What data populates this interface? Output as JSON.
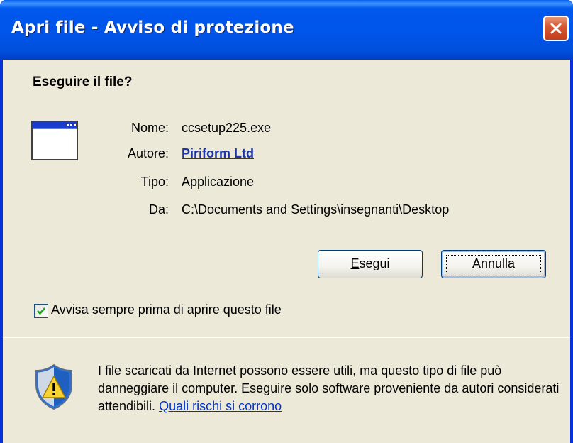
{
  "window": {
    "title": "Apri file - Avviso di protezione"
  },
  "dialog": {
    "question": "Eseguire il file?",
    "fields": {
      "name_label": "Nome:",
      "name_value": "ccsetup225.exe",
      "publisher_label": "Autore:",
      "publisher_value": "Piriform Ltd",
      "type_label": "Tipo:",
      "type_value": "Applicazione",
      "from_label": "Da:",
      "from_value": "C:\\Documents and Settings\\insegnanti\\Desktop"
    },
    "buttons": {
      "run_access": "E",
      "run_rest": "segui",
      "cancel": "Annulla"
    },
    "checkbox": {
      "checked": true,
      "label_pre": "A",
      "label_access": "v",
      "label_post": "visa sempre prima di aprire questo file"
    },
    "warning": {
      "text": "I file scaricati da Internet possono essere utili, ma questo tipo di file può danneggiare il computer. Eseguire solo software proveniente da autori considerati attendibili. ",
      "link": "Quali rischi si corrono"
    }
  },
  "icons": [
    "close-icon",
    "application-icon",
    "checkmark-icon",
    "security-shield-icon"
  ],
  "colors": {
    "titlebar": "#0054e3",
    "dialog_bg": "#ece9d8",
    "close": "#d65a36",
    "link": "#0033cc"
  }
}
